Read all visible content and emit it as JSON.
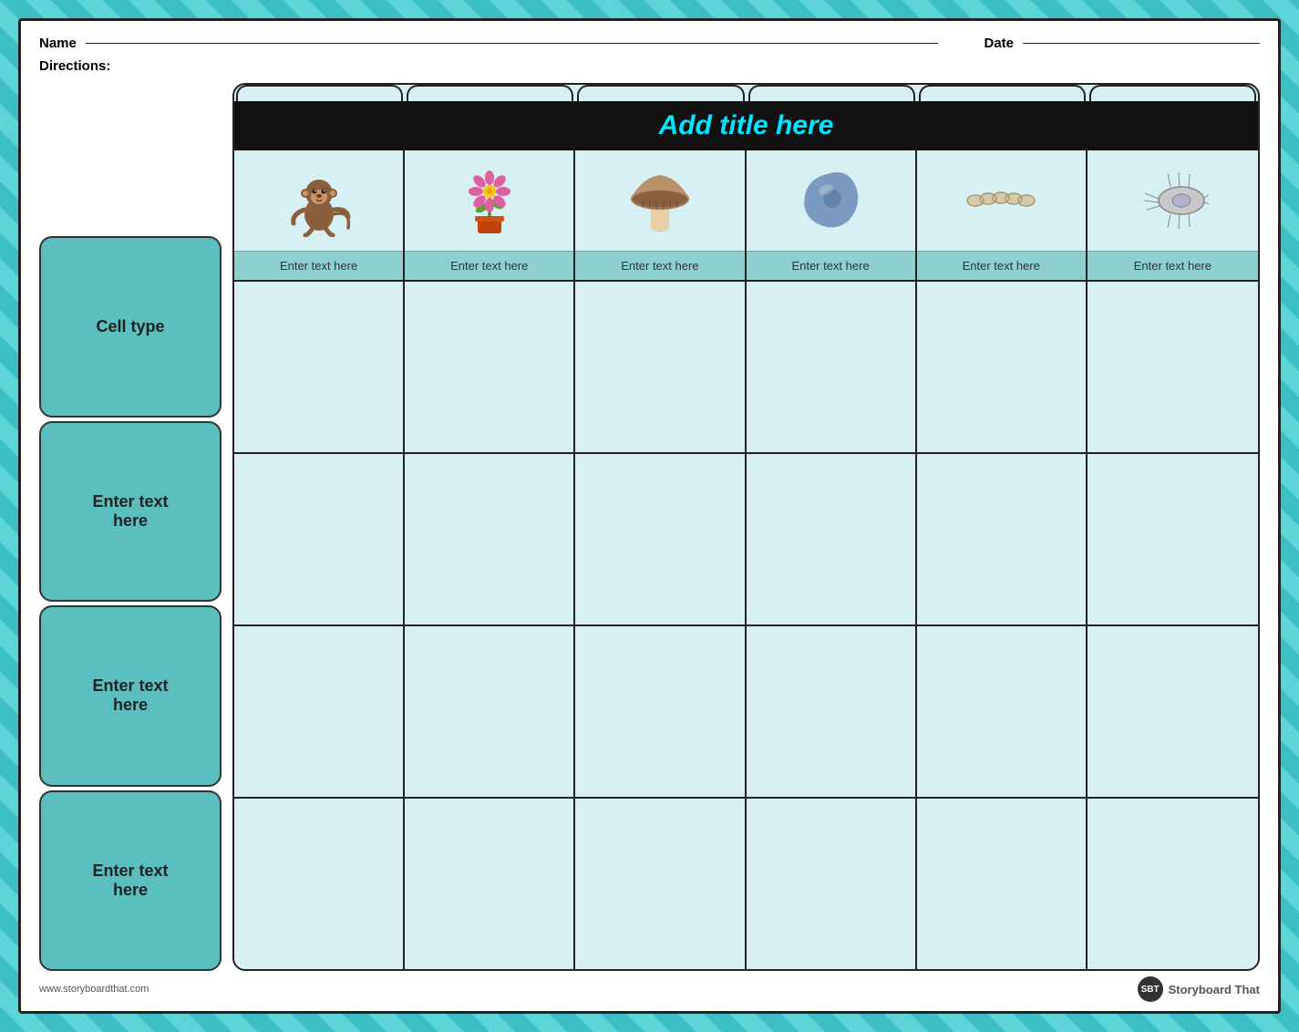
{
  "page": {
    "background_color": "#5dd4d8"
  },
  "header": {
    "name_label": "Name",
    "date_label": "Date",
    "directions_label": "Directions:"
  },
  "title_bar": {
    "text": "Add title here"
  },
  "columns": [
    {
      "id": "col1",
      "image_type": "monkey",
      "label": "Enter text here"
    },
    {
      "id": "col2",
      "image_type": "flower",
      "label": "Enter text here"
    },
    {
      "id": "col3",
      "image_type": "mushroom",
      "label": "Enter text here"
    },
    {
      "id": "col4",
      "image_type": "amoeba",
      "label": "Enter text here"
    },
    {
      "id": "col5",
      "image_type": "bacteria",
      "label": "Enter text here"
    },
    {
      "id": "col6",
      "image_type": "paramecium",
      "label": "Enter text here"
    }
  ],
  "row_labels": [
    "Cell type",
    "Enter text here",
    "Enter text here",
    "Enter text here"
  ],
  "footer": {
    "website": "www.storyboardthat.com",
    "brand": "Storyboard That"
  }
}
